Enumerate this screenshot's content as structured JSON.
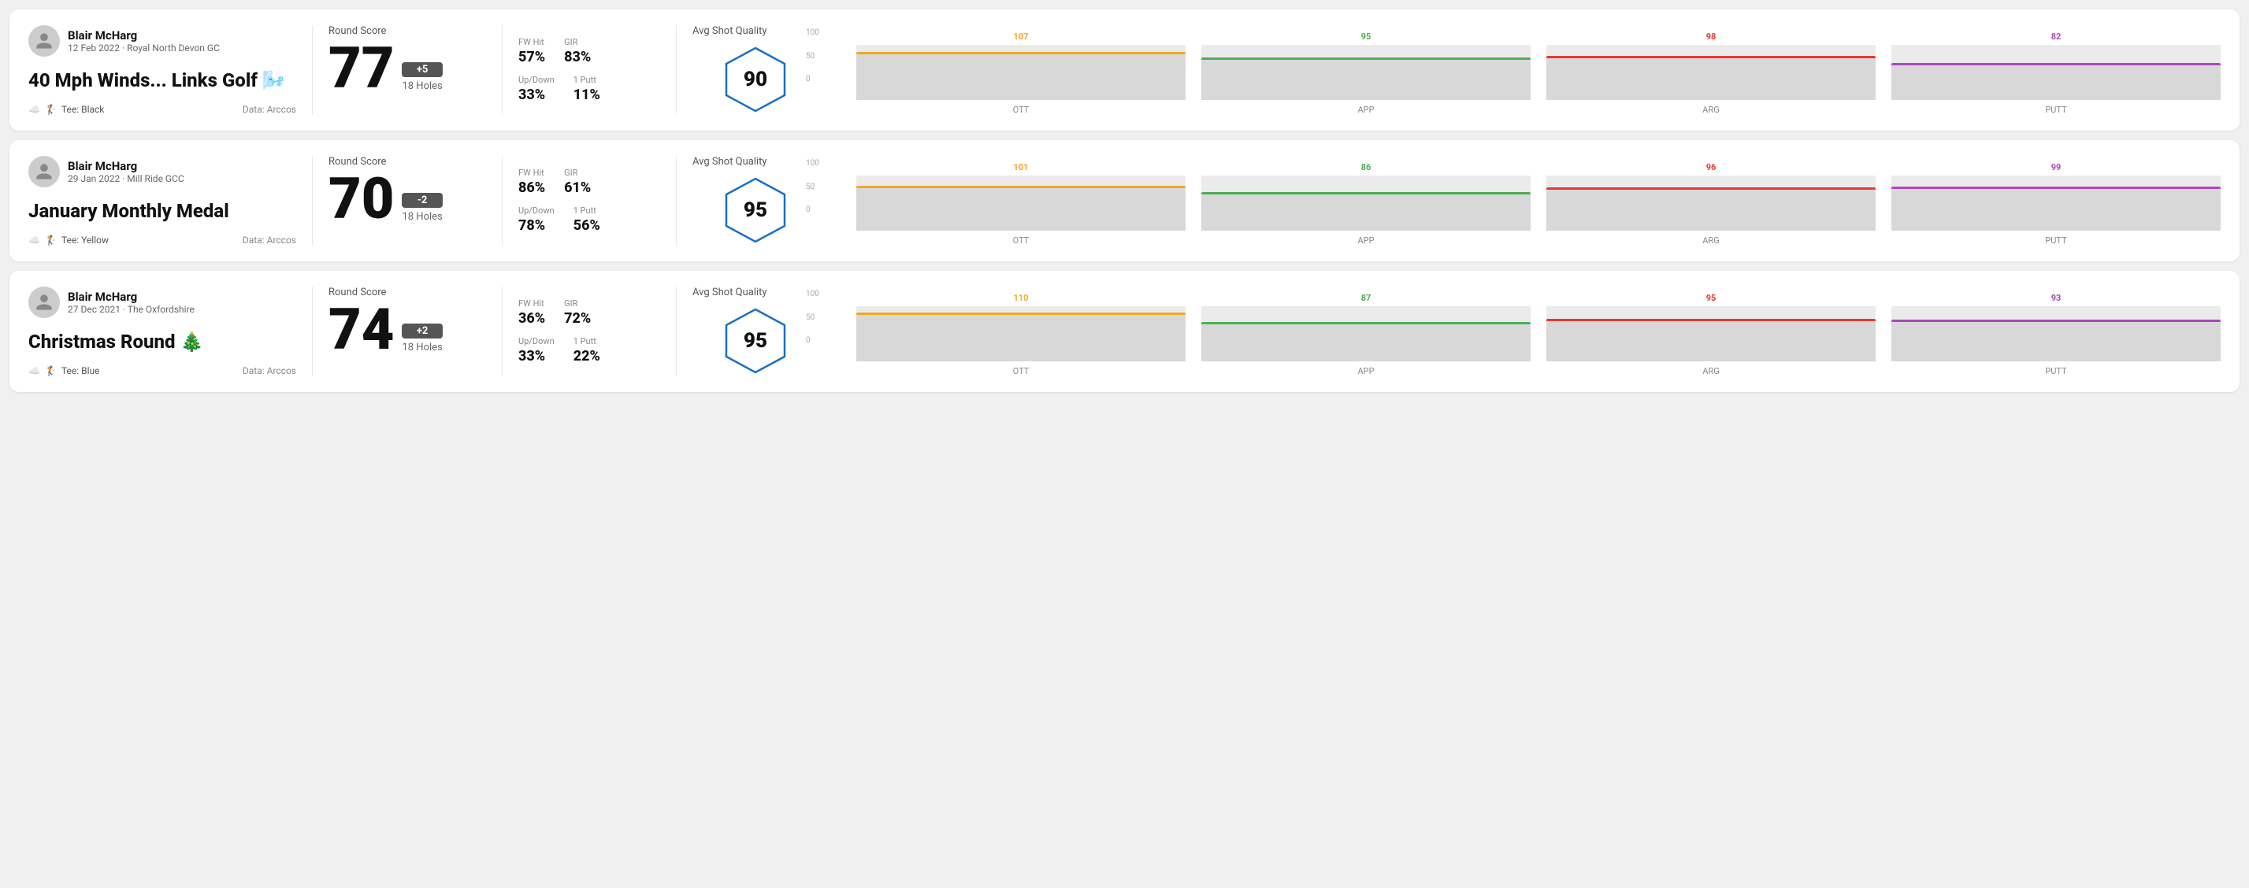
{
  "rounds": [
    {
      "id": "round1",
      "user": {
        "name": "Blair McHarg",
        "date_course": "12 Feb 2022 · Royal North Devon GC"
      },
      "title": "40 Mph Winds... Links Golf 🌬️",
      "tee": "Black",
      "data_source": "Data: Arccos",
      "score": {
        "number": "77",
        "badge": "+5",
        "badge_type": "positive",
        "holes": "18 Holes"
      },
      "stats": {
        "fw_hit_label": "FW Hit",
        "fw_hit_value": "57%",
        "gir_label": "GIR",
        "gir_value": "83%",
        "updown_label": "Up/Down",
        "updown_value": "33%",
        "oneputt_label": "1 Putt",
        "oneputt_value": "11%"
      },
      "quality": {
        "label": "Avg Shot Quality",
        "value": "90"
      },
      "chart": {
        "bars": [
          {
            "label": "OTT",
            "value": 107,
            "max": 130,
            "color": "#f5a623"
          },
          {
            "label": "APP",
            "value": 95,
            "max": 130,
            "color": "#4caf50"
          },
          {
            "label": "ARG",
            "value": 98,
            "max": 130,
            "color": "#e53935"
          },
          {
            "label": "PUTT",
            "value": 82,
            "max": 130,
            "color": "#ab47bc"
          }
        ],
        "y_labels": [
          "100",
          "50",
          "0"
        ]
      }
    },
    {
      "id": "round2",
      "user": {
        "name": "Blair McHarg",
        "date_course": "29 Jan 2022 · Mill Ride GCC"
      },
      "title": "January Monthly Medal",
      "tee": "Yellow",
      "data_source": "Data: Arccos",
      "score": {
        "number": "70",
        "badge": "-2",
        "badge_type": "negative",
        "holes": "18 Holes"
      },
      "stats": {
        "fw_hit_label": "FW Hit",
        "fw_hit_value": "86%",
        "gir_label": "GIR",
        "gir_value": "61%",
        "updown_label": "Up/Down",
        "updown_value": "78%",
        "oneputt_label": "1 Putt",
        "oneputt_value": "56%"
      },
      "quality": {
        "label": "Avg Shot Quality",
        "value": "95"
      },
      "chart": {
        "bars": [
          {
            "label": "OTT",
            "value": 101,
            "max": 130,
            "color": "#f5a623"
          },
          {
            "label": "APP",
            "value": 86,
            "max": 130,
            "color": "#4caf50"
          },
          {
            "label": "ARG",
            "value": 96,
            "max": 130,
            "color": "#e53935"
          },
          {
            "label": "PUTT",
            "value": 99,
            "max": 130,
            "color": "#ab47bc"
          }
        ],
        "y_labels": [
          "100",
          "50",
          "0"
        ]
      }
    },
    {
      "id": "round3",
      "user": {
        "name": "Blair McHarg",
        "date_course": "27 Dec 2021 · The Oxfordshire"
      },
      "title": "Christmas Round 🎄",
      "tee": "Blue",
      "data_source": "Data: Arccos",
      "score": {
        "number": "74",
        "badge": "+2",
        "badge_type": "positive",
        "holes": "18 Holes"
      },
      "stats": {
        "fw_hit_label": "FW Hit",
        "fw_hit_value": "36%",
        "gir_label": "GIR",
        "gir_value": "72%",
        "updown_label": "Up/Down",
        "updown_value": "33%",
        "oneputt_label": "1 Putt",
        "oneputt_value": "22%"
      },
      "quality": {
        "label": "Avg Shot Quality",
        "value": "95"
      },
      "chart": {
        "bars": [
          {
            "label": "OTT",
            "value": 110,
            "max": 130,
            "color": "#f5a623"
          },
          {
            "label": "APP",
            "value": 87,
            "max": 130,
            "color": "#4caf50"
          },
          {
            "label": "ARG",
            "value": 95,
            "max": 130,
            "color": "#e53935"
          },
          {
            "label": "PUTT",
            "value": 93,
            "max": 130,
            "color": "#ab47bc"
          }
        ],
        "y_labels": [
          "100",
          "50",
          "0"
        ]
      }
    }
  ]
}
